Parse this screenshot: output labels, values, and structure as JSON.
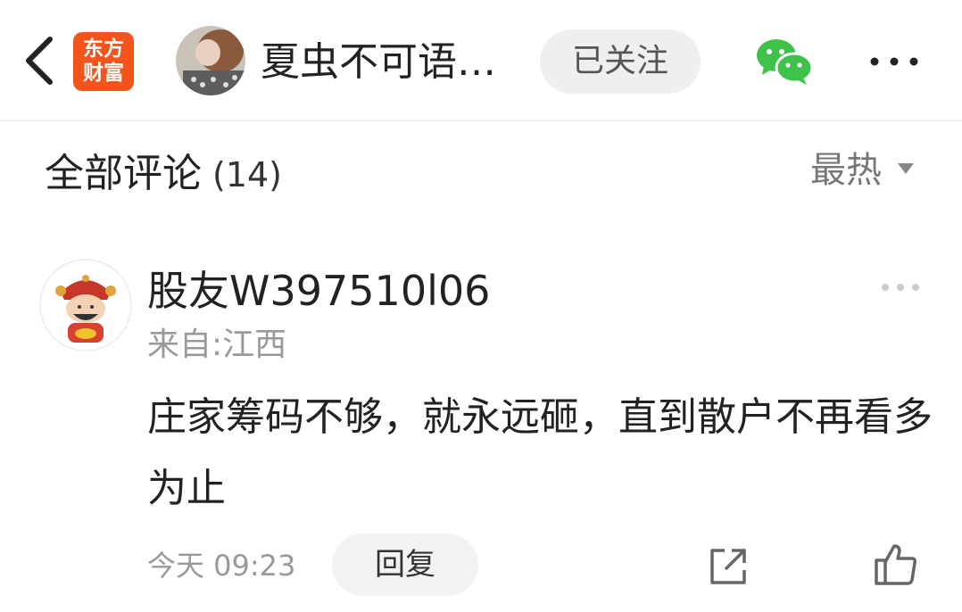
{
  "header": {
    "logo_line1": "东方",
    "logo_line2": "财富",
    "author_name": "夏虫不可语…",
    "follow_label": "已关注",
    "icons": [
      "back-icon",
      "wechat-icon",
      "more-icon"
    ]
  },
  "comments_section": {
    "title": "全部评论",
    "count": "(14)",
    "sort_label": "最热"
  },
  "comment": {
    "username": "股友W397510l06",
    "location": "来自:江西",
    "text": "庄家筹码不够，就永远砸，直到散户不再看多为止",
    "time": "今天 09:23",
    "reply_label": "回复"
  },
  "colors": {
    "brand_orange": "#f2541b",
    "wechat_green": "#3ec24a",
    "muted_gray": "#999999",
    "button_bg": "#efefef"
  }
}
